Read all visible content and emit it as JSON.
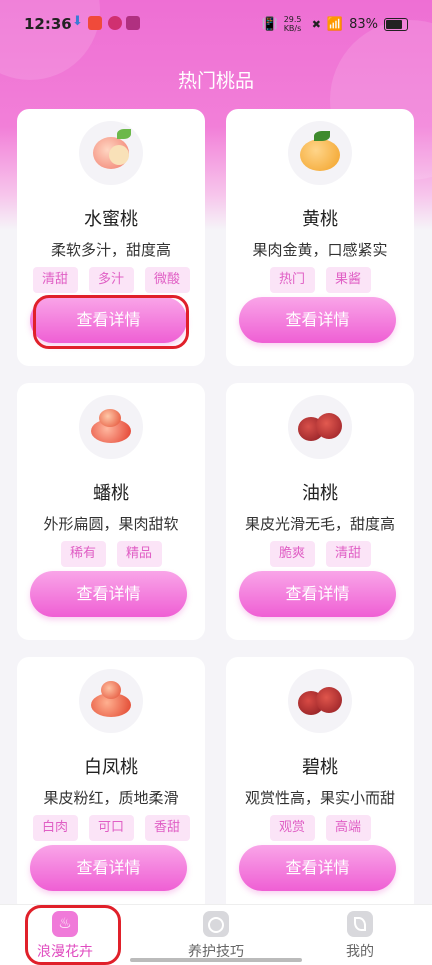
{
  "status_bar": {
    "time": "12:36",
    "network_speed": "29.5 KB/s",
    "battery": "83%"
  },
  "page": {
    "title": "热门桃品"
  },
  "items": [
    {
      "name": "水蜜桃",
      "desc": "柔软多汁，甜度高",
      "tags": [
        "清甜",
        "多汁",
        "微酸"
      ],
      "button": "查看详情"
    },
    {
      "name": "黄桃",
      "desc": "果肉金黄，口感紧实",
      "tags": [
        "热门",
        "果酱"
      ],
      "button": "查看详情"
    },
    {
      "name": "蟠桃",
      "desc": "外形扁圆，果肉甜软",
      "tags": [
        "稀有",
        "精品"
      ],
      "button": "查看详情"
    },
    {
      "name": "油桃",
      "desc": "果皮光滑无毛，甜度高",
      "tags": [
        "脆爽",
        "清甜"
      ],
      "button": "查看详情"
    },
    {
      "name": "白凤桃",
      "desc": "果皮粉红，质地柔滑",
      "tags": [
        "白肉",
        "可口",
        "香甜"
      ],
      "button": "查看详情"
    },
    {
      "name": "碧桃",
      "desc": "观赏性高，果实小而甜",
      "tags": [
        "观赏",
        "高端"
      ],
      "button": "查看详情"
    }
  ],
  "tabbar": {
    "tabs": [
      {
        "label": "浪漫花卉",
        "icon": "flame-icon",
        "active": true
      },
      {
        "label": "养护技巧",
        "icon": "tomato-icon",
        "active": false
      },
      {
        "label": "我的",
        "icon": "leaf-icon",
        "active": false
      }
    ]
  },
  "colors": {
    "accent": "#ef5fd4",
    "tag_bg": "#fbe4f7",
    "tag_text": "#e05fc5",
    "highlight": "#e0202a"
  }
}
